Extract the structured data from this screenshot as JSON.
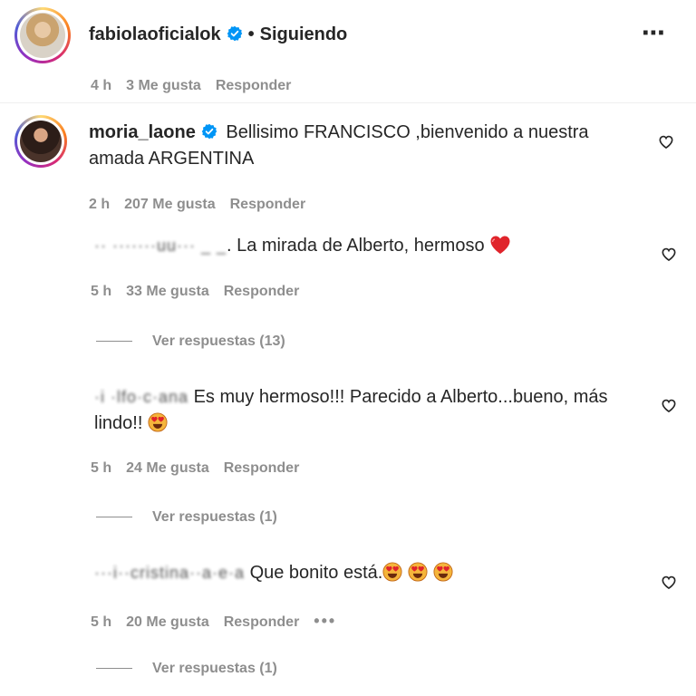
{
  "post_header": {
    "username": "fabiolaoficialok",
    "separator": "•",
    "follow_status": "Siguiendo",
    "more_icon": "⋯"
  },
  "top_meta": {
    "time": "4 h",
    "likes": "3 Me gusta",
    "reply": "Responder"
  },
  "comments": [
    {
      "username": "moria_laone",
      "text_line1": "Bellisimo FRANCISCO ,bienvenido a nuestra",
      "text_line2": "amada ARGENTINA",
      "time": "2 h",
      "likes": "207 Me gusta",
      "reply": "Responder"
    },
    {
      "username_obscured": "·· ·······uu··· _ _",
      "text": ". La mirada de Alberto, hermoso",
      "emoji": "red-heart",
      "time": "5 h",
      "likes": "33 Me gusta",
      "reply": "Responder",
      "view_replies": "Ver respuestas (13)"
    },
    {
      "username_obscured": "·i ·lfo·c·ana",
      "text_line1": "Es muy hermoso!!! Parecido a Alberto...bueno, más",
      "text_line2": "lindo!!",
      "emoji": "heart-eyes",
      "time": "5 h",
      "likes": "24 Me gusta",
      "reply": "Responder",
      "view_replies": "Ver respuestas (1)"
    },
    {
      "username_obscured": "···i··cristina··a·e·a",
      "text": "Que bonito está.",
      "emoji": "heart-eyes x3",
      "time": "5 h",
      "likes": "20 Me gusta",
      "reply": "Responder",
      "more": "•••",
      "view_replies": "Ver respuestas (1)"
    }
  ],
  "colors": {
    "text": "#262626",
    "secondary": "#8e8e8e",
    "verified": "#0095f6",
    "heart_emoji": "#e0242b"
  }
}
